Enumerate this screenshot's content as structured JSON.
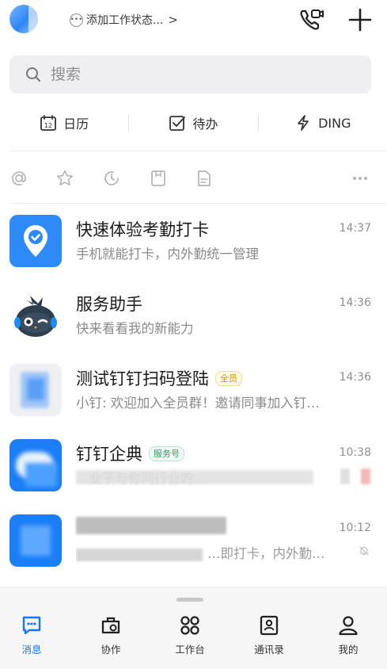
{
  "header": {
    "status_label": "添加工作状态...",
    "status_chevron": ">",
    "status_icon": "chat-bubble-icon",
    "call_icon": "phone-video-icon",
    "add_icon": "plus-icon"
  },
  "search": {
    "placeholder": "搜索"
  },
  "shortcuts": [
    {
      "label": "日历",
      "icon": "calendar-icon"
    },
    {
      "label": "待办",
      "icon": "checkbox-icon"
    },
    {
      "label": "DING",
      "icon": "lightning-icon"
    }
  ],
  "filters": [
    {
      "icon": "at-icon"
    },
    {
      "icon": "star-icon"
    },
    {
      "icon": "clock-icon"
    },
    {
      "icon": "bookmark-box-icon"
    },
    {
      "icon": "document-icon"
    },
    {
      "icon": "more-icon"
    }
  ],
  "messages": [
    {
      "title": "快速体验考勤打卡",
      "subtitle": "手机就能打卡，内外勤统一管理",
      "time": "14:37",
      "avatar": "location-pin-icon"
    },
    {
      "title": "服务助手",
      "subtitle": "快来看看我的新能力",
      "time": "14:36",
      "avatar": "robot-avatar"
    },
    {
      "title": "测试钉钉扫码登陆",
      "tag": "全员",
      "subtitle": "小钉: 欢迎加入全员群！邀请同事加入钉…",
      "time": "14:36",
      "avatar": "group-avatar"
    },
    {
      "title": "钉钉企典",
      "tag": "服务号",
      "subtitle": "…业子与你同行业的…",
      "time": "10:38",
      "avatar": "cloud-avatar"
    },
    {
      "title": "",
      "subtitle": "…即打卡，内外勤…",
      "time": "10:12",
      "avatar": "blurred-avatar",
      "mute_icon": "bell-off-icon"
    }
  ],
  "nav": [
    {
      "label": "消息",
      "icon": "message-icon",
      "active": true
    },
    {
      "label": "协作",
      "icon": "collab-icon",
      "active": false
    },
    {
      "label": "工作台",
      "icon": "grid-icon",
      "active": false
    },
    {
      "label": "通讯录",
      "icon": "contacts-icon",
      "active": false
    },
    {
      "label": "我的",
      "icon": "person-icon",
      "active": false
    }
  ],
  "colors": {
    "accent": "#1677ff",
    "active_nav": "#1677ff"
  }
}
